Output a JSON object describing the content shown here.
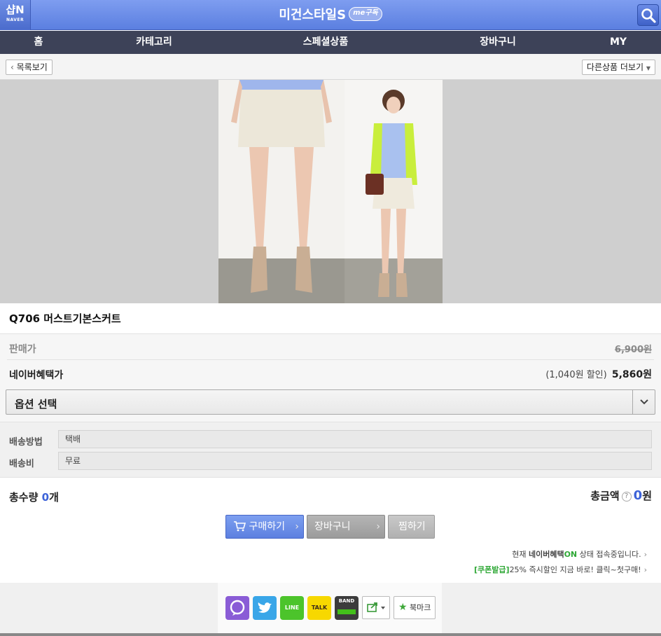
{
  "header": {
    "logo_main": "샵N",
    "logo_sub": "NAVER",
    "store_name": "미건스타일S",
    "subscribe_badge": "me구독"
  },
  "nav": {
    "items": [
      {
        "label": "홈"
      },
      {
        "label": "카테고리"
      },
      {
        "label": "스페셜상품"
      },
      {
        "label": "장바구니"
      },
      {
        "label": "MY"
      }
    ]
  },
  "toolbar": {
    "back_label": "목록보기",
    "more_label": "다른상품 더보기"
  },
  "product": {
    "title": "Q706 머스트기본스커트",
    "price_label": "판매가",
    "original_price": "6,900원",
    "benefit_label": "네이버혜택가",
    "discount_note": "(1,040원 할인)",
    "benefit_price": "5,860원"
  },
  "option": {
    "label": "옵션 선택"
  },
  "shipping": {
    "method_label": "배송방법",
    "method_value": "택배",
    "fee_label": "배송비",
    "fee_value": "무료"
  },
  "totals": {
    "qty_label": "총수량",
    "qty_value": "0",
    "qty_unit": "개",
    "amount_label": "총금액",
    "amount_value": "0",
    "amount_unit": "원"
  },
  "actions": {
    "buy_label": "구매하기",
    "cart_label": "장바구니",
    "wish_label": "찜하기"
  },
  "notices": {
    "status_prefix": "현재 ",
    "status_brand": "네이버혜택",
    "status_on": "ON",
    "status_suffix": " 상태 접속중입니다.",
    "coupon_tag": "[쿠폰발급]",
    "coupon_text": "25% 즉시할인 지금 바로! 클릭~첫구매!"
  },
  "share": {
    "line_label": "LINE",
    "talk_label": "TALK",
    "band_label": "BAND",
    "bookmark_label": "북마크"
  },
  "colors": {
    "header_blue": "#6a8ae6",
    "nav_dark": "#3d4258",
    "accent_blue": "#3d63d8",
    "green": "#2fa836"
  }
}
